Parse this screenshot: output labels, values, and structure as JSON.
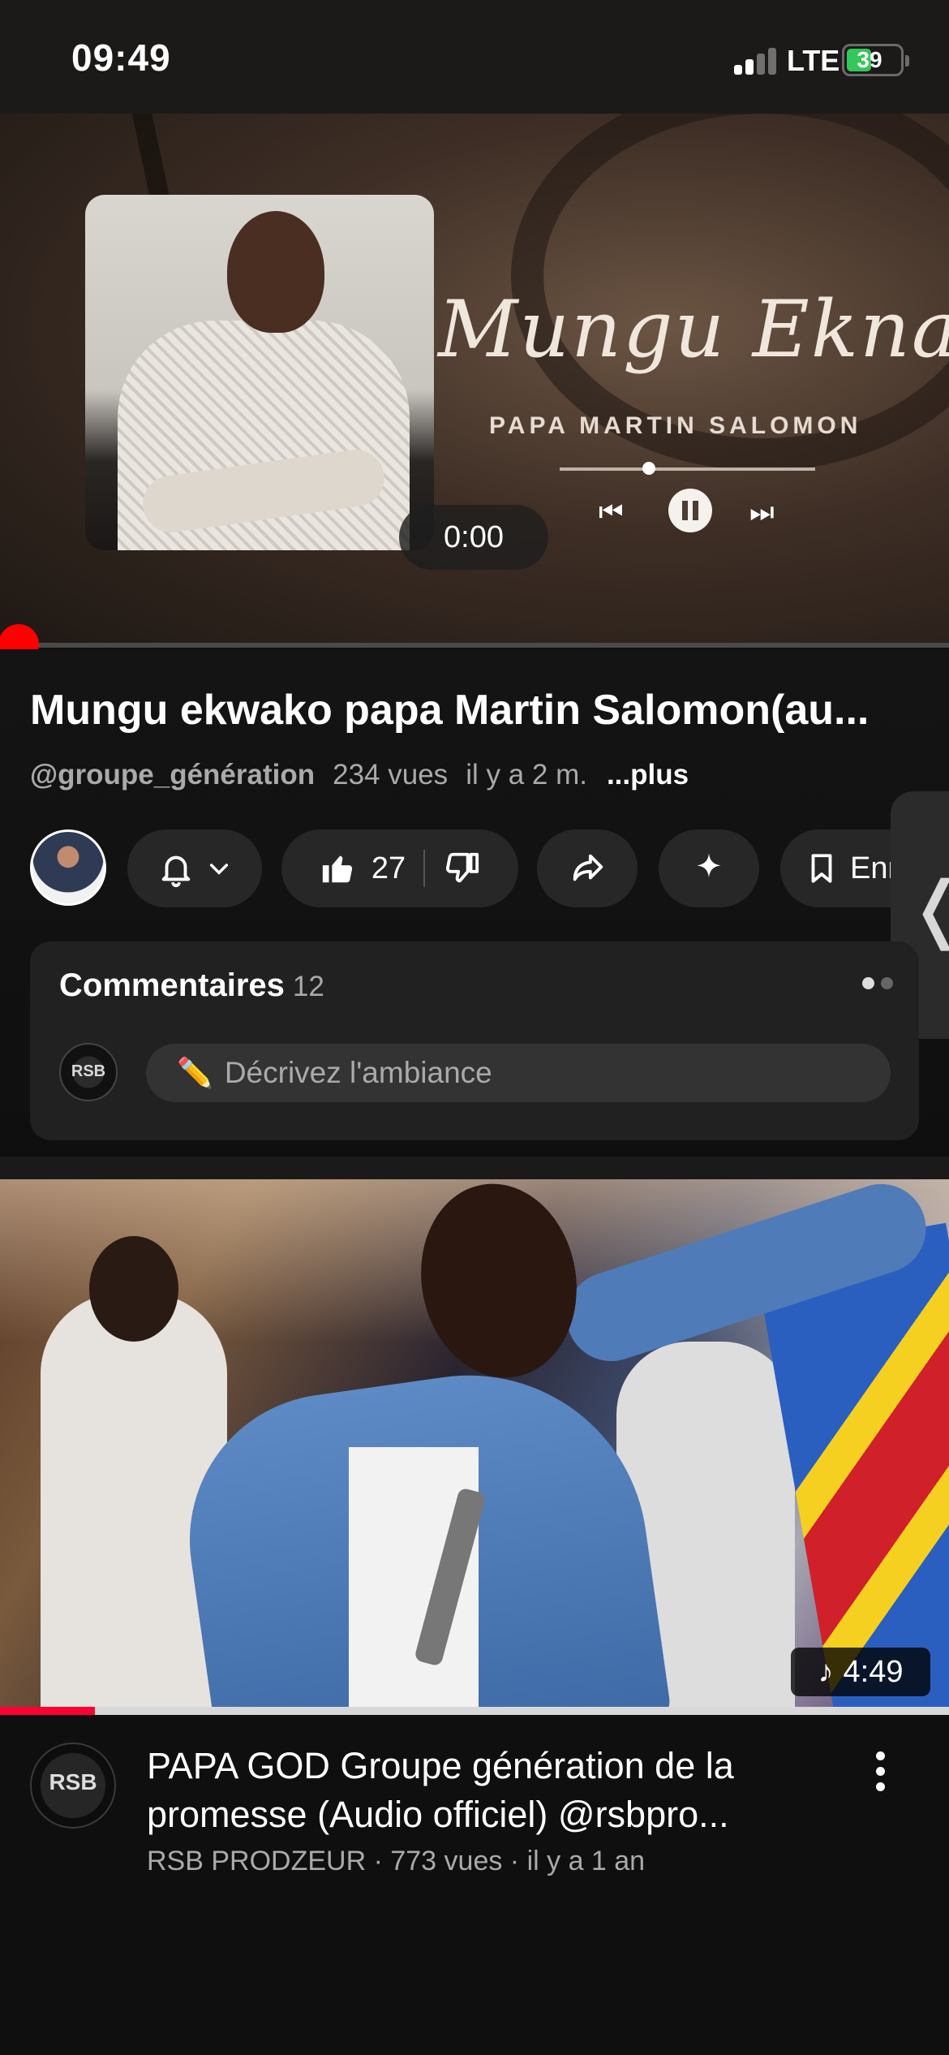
{
  "status_bar": {
    "time": "09:49",
    "network": "LTE",
    "battery": "39"
  },
  "player": {
    "song_title": "Mungu Eknako",
    "song_artist": "PAPA MARTIN SALOMON",
    "current_time": "0:00",
    "progress": 0
  },
  "video": {
    "title": "Mungu ekwako papa Martin Salomon(au...",
    "channel": "@groupe_génération",
    "views": "234 vues",
    "age": "il y a 2 m.",
    "more": "...plus"
  },
  "actions": {
    "like_count": "27",
    "save_label": "Enr"
  },
  "comments": {
    "title": "Commentaires",
    "count": "12",
    "placeholder": "Décrivez l'ambiance",
    "avatar_text": "RSB"
  },
  "recommended": {
    "title_line1": "PAPA GOD Groupe génération de la",
    "title_line2": "promesse (Audio officiel) @rsbpro...",
    "meta": "RSB PRODZEUR · 773 vues · il y a 1 an",
    "duration": "4:49",
    "avatar_text": "RSB",
    "watched_fraction": 0.1
  },
  "colors": {
    "accent": "#ff0000",
    "background": "#0f0f0f",
    "pill": "#272727"
  },
  "icons": [
    "bell-icon",
    "chevron-down-icon",
    "thumbs-up-icon",
    "thumbs-down-icon",
    "share-icon",
    "sparkle-icon",
    "bookmark-icon",
    "pencil-icon",
    "music-note-icon",
    "more-vertical-icon"
  ]
}
